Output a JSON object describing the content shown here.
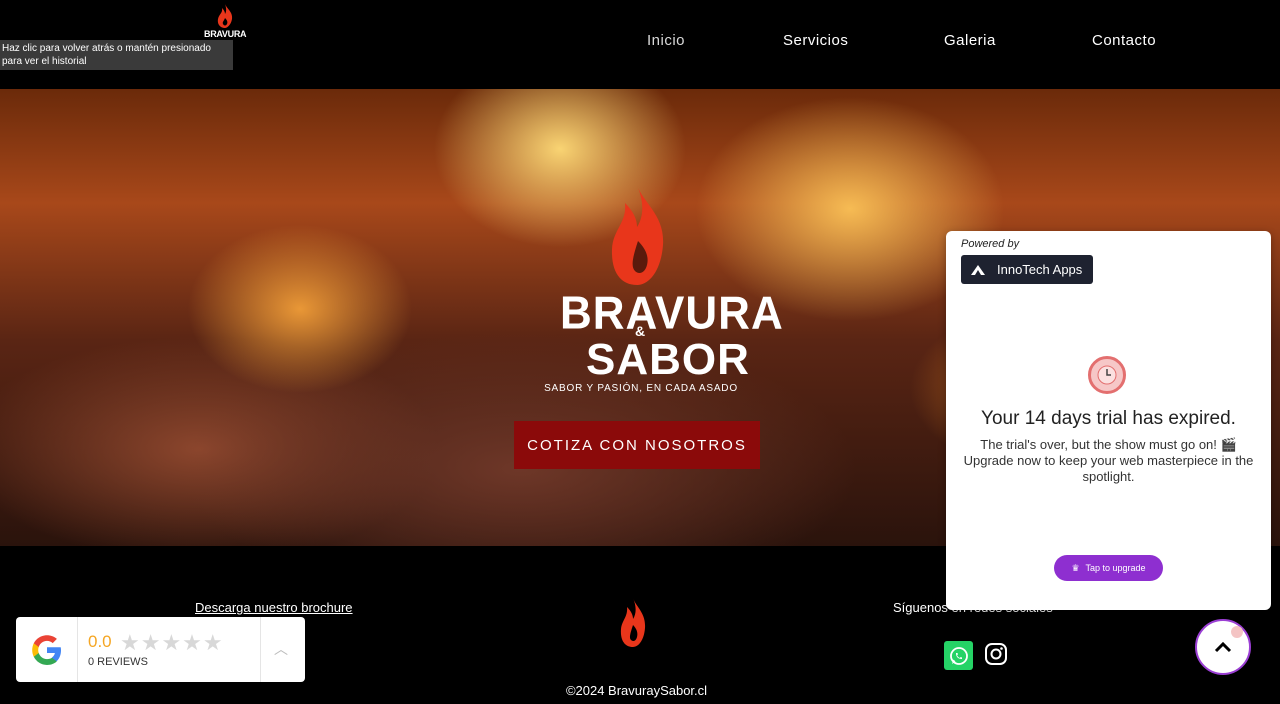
{
  "header": {
    "brand_text": "BRAVURA",
    "tooltip_line1": "Haz clic para volver atrás o mantén presionado",
    "tooltip_line2": "para ver el historial",
    "nav": [
      "Inicio",
      "Servicios",
      "Galeria",
      "Contacto"
    ],
    "active_nav": "Inicio"
  },
  "hero": {
    "logo_word1": "BRAVURA",
    "logo_amp": "&",
    "logo_word2": "SABOR",
    "slogan": "SABOR Y PASIÓN, EN CADA ASADO",
    "cta_label": "COTIZA CON NOSOTROS"
  },
  "footer": {
    "brochure_link": "Descarga nuestro brochure",
    "social_title": "Síguenos en redes sociales",
    "copyright": "©2024 BravuraySabor.cl",
    "social_icons": [
      "whatsapp-icon",
      "instagram-icon"
    ]
  },
  "google_widget": {
    "score": "0.0",
    "stars": "★★★★★",
    "reviews": "0 REVIEWS"
  },
  "trial_popup": {
    "powered_by": "Powered by",
    "vendor": "InnoTech Apps",
    "title": "Your 14 days trial has expired.",
    "line1": "The trial's over, but the show must go on! 🎬",
    "line2": "Upgrade now to keep your web masterpiece in the spotlight.",
    "button": "Tap to upgrade"
  },
  "colors": {
    "accent_red": "#8b0a0a",
    "flame_red": "#e8361b",
    "upgrade_purple": "#8e2fd0",
    "whatsapp_green": "#25d366"
  }
}
